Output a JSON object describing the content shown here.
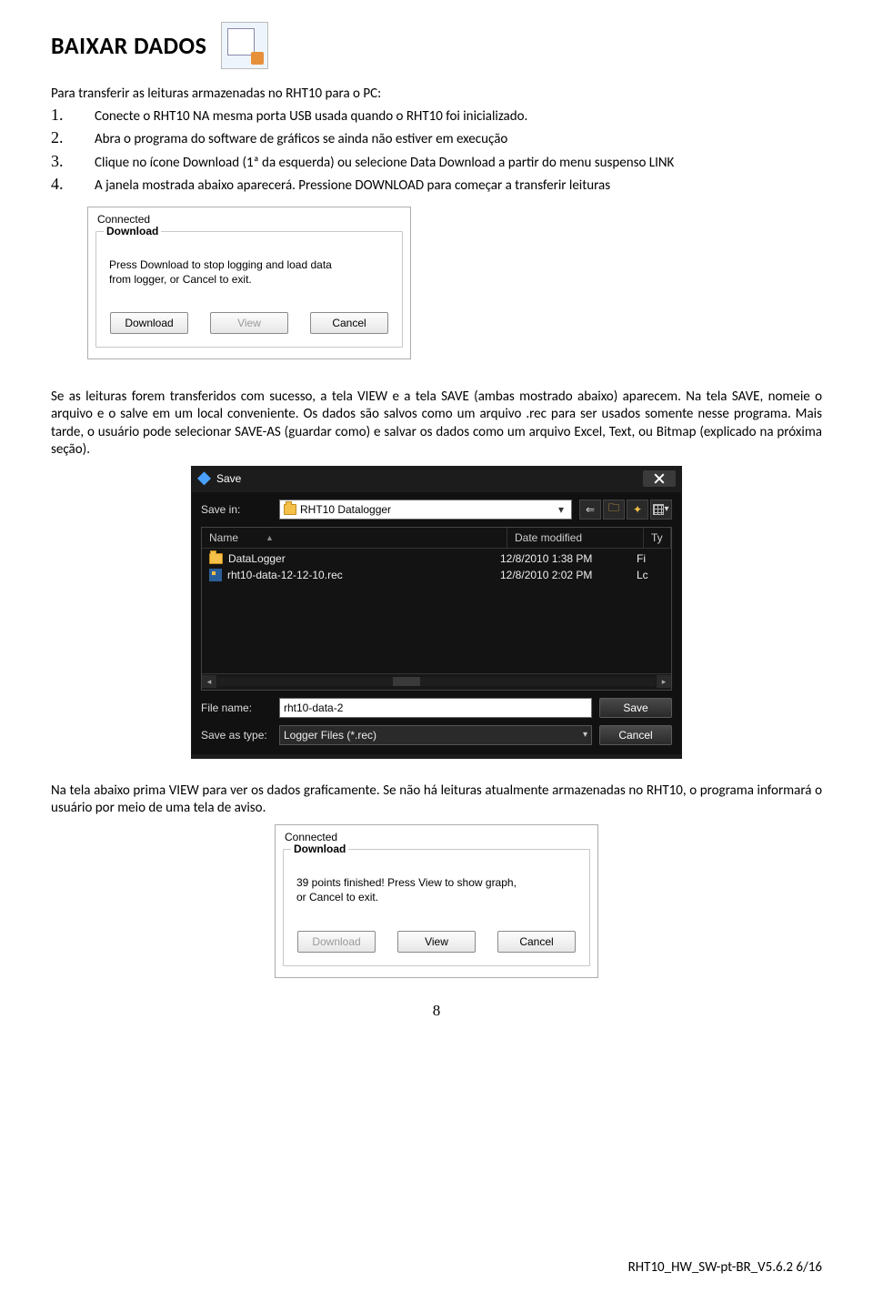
{
  "title": "BAIXAR DADOS",
  "intro": "Para transferir as leituras armazenadas no RHT10 para o PC:",
  "steps": [
    "Conecte o RHT10 NA mesma porta USB usada quando o RHT10 foi inicializado.",
    "Abra o programa do software de gráficos se ainda não estiver em execução",
    "Clique no ícone Download (1ª da esquerda) ou selecione Data Download a partir do menu suspenso LINK",
    "A janela mostrada abaixo aparecerá. Pressione DOWNLOAD para começar a transferir leituras"
  ],
  "dialog1": {
    "status": "Connected",
    "legend": "Download",
    "msg_line1": "Press Download to stop logging and load data",
    "msg_line2": "from logger, or Cancel to exit.",
    "btn_download": "Download",
    "btn_view": "View",
    "btn_cancel": "Cancel"
  },
  "para1": "Se as leituras forem transferidos com sucesso, a tela VIEW e a tela SAVE (ambas mostrado abaixo) aparecem. Na tela SAVE, nomeie o arquivo e o salve em um local conveniente. Os dados são salvos como um arquivo .rec para ser usados somente nesse programa. Mais tarde, o usuário pode selecionar SAVE-AS (guardar como) e salvar os dados como um arquivo Excel, Text, ou Bitmap (explicado na próxima seção).",
  "save_dialog": {
    "title": "Save",
    "save_in_label": "Save in:",
    "folder": "RHT10 Datalogger",
    "cols": {
      "name": "Name",
      "date": "Date modified",
      "type": "Ty"
    },
    "rows": [
      {
        "icon": "folder",
        "name": "DataLogger",
        "date": "12/8/2010 1:38 PM",
        "type": "Fi"
      },
      {
        "icon": "file",
        "name": "rht10-data-12-12-10.rec",
        "date": "12/8/2010 2:02 PM",
        "type": "Lc"
      }
    ],
    "file_name_label": "File name:",
    "file_name_value": "rht10-data-2",
    "save_type_label": "Save as type:",
    "save_type_value": "Logger Files (*.rec)",
    "btn_save": "Save",
    "btn_cancel": "Cancel"
  },
  "para2": "Na tela abaixo prima VIEW para ver os dados graficamente. Se não há leituras atualmente armazenadas no RHT10, o programa informará o usuário por meio de uma tela de aviso.",
  "dialog3": {
    "status": "Connected",
    "legend": "Download",
    "msg_line1": "39 points finished! Press View to show graph,",
    "msg_line2": "or Cancel to exit.",
    "btn_download": "Download",
    "btn_view": "View",
    "btn_cancel": "Cancel"
  },
  "page_number": "8",
  "footer": "RHT10_HW_SW-pt-BR_V5.6.2    6/16"
}
